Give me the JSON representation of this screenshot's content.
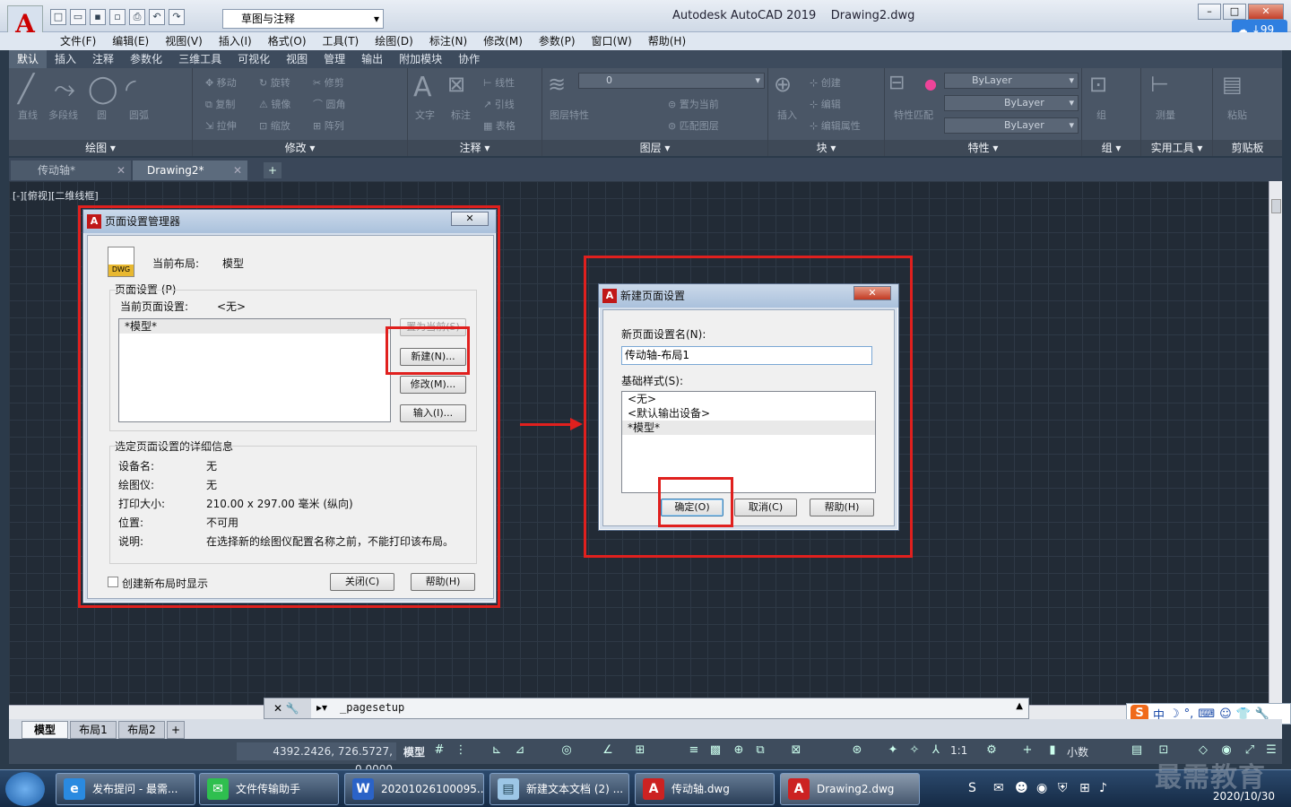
{
  "app": {
    "logo_letter": "A",
    "title": "Autodesk AutoCAD 2019",
    "document": "Drawing2.dwg",
    "workspace": "草图与注释",
    "cloud_badge": "99"
  },
  "menubar": [
    "文件(F)",
    "编辑(E)",
    "视图(V)",
    "插入(I)",
    "格式(O)",
    "工具(T)",
    "绘图(D)",
    "标注(N)",
    "修改(M)",
    "参数(P)",
    "窗口(W)",
    "帮助(H)"
  ],
  "ribbon_tabs": [
    "默认",
    "插入",
    "注释",
    "参数化",
    "三维工具",
    "可视化",
    "视图",
    "管理",
    "输出",
    "附加模块",
    "协作"
  ],
  "ribbon": {
    "draw": {
      "title": "绘图",
      "items": [
        "直线",
        "多段线",
        "圆",
        "圆弧"
      ]
    },
    "modify": {
      "title": "修改",
      "items": [
        "移动",
        "旋转",
        "修剪",
        "复制",
        "镜像",
        "圆角",
        "拉伸",
        "缩放",
        "阵列"
      ]
    },
    "annotation": {
      "title": "注释",
      "items": [
        "文字",
        "标注",
        "线性",
        "引线",
        "表格"
      ]
    },
    "layers": {
      "title": "图层",
      "current_layer": "0",
      "items": [
        "图层特性",
        "置为当前",
        "匹配图层"
      ]
    },
    "block": {
      "title": "块",
      "items": [
        "插入",
        "创建",
        "编辑",
        "编辑属性"
      ]
    },
    "properties": {
      "title": "特性",
      "color": "ByLayer",
      "linetype": "ByLayer",
      "lineweight": "ByLayer",
      "items": [
        "特性匹配"
      ]
    },
    "groups": {
      "title": "组",
      "items": [
        "组"
      ]
    },
    "utilities": {
      "title": "实用工具",
      "items": [
        "测量"
      ]
    },
    "clipboard": {
      "title": "剪贴板",
      "items": [
        "粘贴"
      ]
    }
  },
  "doc_tabs": [
    {
      "label": "传动轴*",
      "active": false
    },
    {
      "label": "Drawing2*",
      "active": true
    }
  ],
  "viewport_label": "[-][俯视][二维线框]",
  "page_setup_manager": {
    "title": "页面设置管理器",
    "current_layout_label": "当前布局:",
    "current_layout_value": "模型",
    "group_label": "页面设置 (P)",
    "current_setup_label": "当前页面设置:",
    "current_setup_value": "<无>",
    "list_items": [
      "*模型*"
    ],
    "buttons": {
      "set_current": "置为当前(S)",
      "new": "新建(N)...",
      "modify": "修改(M)...",
      "import": "输入(I)..."
    },
    "details_label": "选定页面设置的详细信息",
    "details": [
      {
        "key": "设备名:",
        "value": "无"
      },
      {
        "key": "绘图仪:",
        "value": "无"
      },
      {
        "key": "打印大小:",
        "value": "210.00 x 297.00 毫米 (纵向)"
      },
      {
        "key": "位置:",
        "value": "不可用"
      },
      {
        "key": "说明:",
        "value": "在选择新的绘图仪配置名称之前，不能打印该布局。"
      }
    ],
    "show_on_new_layout": "创建新布局时显示",
    "close_label": "关闭(C)",
    "help_label": "帮助(H)"
  },
  "new_page_setup": {
    "title": "新建页面设置",
    "name_label": "新页面设置名(N):",
    "name_value": "传动轴-布局1",
    "base_label": "基础样式(S):",
    "base_items": [
      "<无>",
      "<默认输出设备>",
      "*模型*"
    ],
    "ok_label": "确定(O)",
    "cancel_label": "取消(C)",
    "help_label": "帮助(H)"
  },
  "command_line": {
    "text": "_pagesetup"
  },
  "layout_tabs": [
    {
      "label": "模型",
      "active": true
    },
    {
      "label": "布局1",
      "active": false
    },
    {
      "label": "布局2",
      "active": false
    }
  ],
  "status": {
    "coords": "4392.2426, 726.5727, 0.0000",
    "model_label": "模型",
    "scale": "1:1",
    "units": "小数"
  },
  "ime": {
    "lang": "中"
  },
  "taskbar": [
    {
      "label": "发布提问 - 最需...",
      "icon": "ie-icon"
    },
    {
      "label": "文件传输助手",
      "icon": "wechat-icon"
    },
    {
      "label": "20201026100095...",
      "icon": "word-icon"
    },
    {
      "label": "新建文本文档 (2) ...",
      "icon": "notepad-icon"
    },
    {
      "label": "传动轴.dwg",
      "icon": "autocad-icon"
    },
    {
      "label": "Drawing2.dwg",
      "icon": "autocad-icon"
    }
  ],
  "clock": {
    "date": "2020/10/30"
  },
  "watermark": "最需教育"
}
